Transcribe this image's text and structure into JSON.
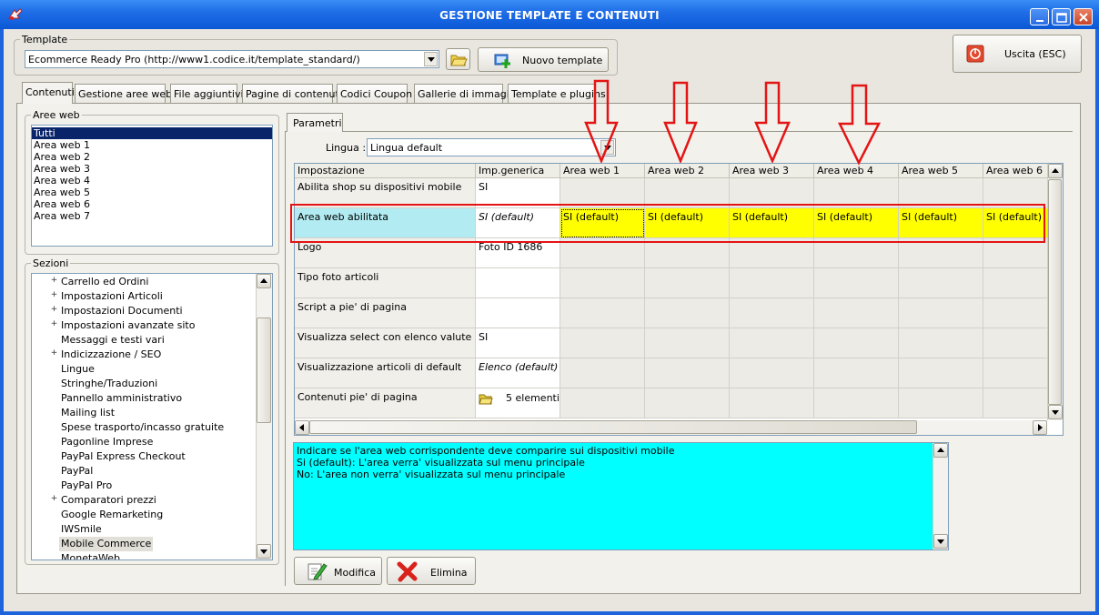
{
  "window": {
    "title": "GESTIONE TEMPLATE E CONTENUTI"
  },
  "template": {
    "legend": "Template",
    "selected": "Ecommerce Ready Pro (http://www1.codice.it/template_standard/)",
    "new_button": "Nuovo template"
  },
  "exit_button": "Uscita (ESC)",
  "tabs": [
    "Contenuti",
    "Gestione aree web",
    "File aggiuntivi",
    "Pagine di contenuti",
    "Codici Coupon",
    "Gallerie di immagini",
    "Template e plugins"
  ],
  "aree_web": {
    "legend": "Aree web",
    "items": [
      "Tutti",
      "Area web 1",
      "Area web 2",
      "Area web 3",
      "Area web 4",
      "Area web 5",
      "Area web 6",
      "Area web 7"
    ]
  },
  "sezioni": {
    "legend": "Sezioni",
    "items": [
      {
        "label": "Carrello ed Ordini",
        "expandable": true
      },
      {
        "label": "Impostazioni Articoli",
        "expandable": true
      },
      {
        "label": "Impostazioni Documenti",
        "expandable": true
      },
      {
        "label": "Impostazioni avanzate sito",
        "expandable": true
      },
      {
        "label": "Messaggi e testi vari",
        "expandable": false
      },
      {
        "label": "Indicizzazione / SEO",
        "expandable": true
      },
      {
        "label": "Lingue",
        "expandable": false
      },
      {
        "label": "Stringhe/Traduzioni",
        "expandable": false
      },
      {
        "label": "Pannello amministrativo",
        "expandable": false
      },
      {
        "label": "Mailing list",
        "expandable": false
      },
      {
        "label": "Spese trasporto/incasso gratuite",
        "expandable": false
      },
      {
        "label": "Pagonline Imprese",
        "expandable": false
      },
      {
        "label": "PayPal Express Checkout",
        "expandable": false
      },
      {
        "label": "PayPal",
        "expandable": false
      },
      {
        "label": "PayPal Pro",
        "expandable": false
      },
      {
        "label": "Comparatori prezzi",
        "expandable": true
      },
      {
        "label": "Google Remarketing",
        "expandable": false
      },
      {
        "label": "IWSmile",
        "expandable": false
      },
      {
        "label": "Mobile Commerce",
        "expandable": false,
        "selected": true
      },
      {
        "label": "MonetaWeb",
        "expandable": false
      }
    ]
  },
  "parametri": {
    "tab": "Parametri",
    "lingua_label": "Lingua :",
    "lingua_value": "Lingua default"
  },
  "grid": {
    "columns": [
      "Impostazione",
      "Imp.generica",
      "Area web 1",
      "Area web 2",
      "Area web 3",
      "Area web 4",
      "Area web 5",
      "Area web 6"
    ],
    "rows": [
      {
        "name": "Abilita shop su dispositivi mobile",
        "generic": "SI",
        "italic": false,
        "areas": [
          "",
          "",
          "",
          "",
          "",
          ""
        ]
      },
      {
        "name": "Area web abilitata",
        "generic": "SI (default)",
        "italic": true,
        "highlight": true,
        "areas": [
          "SI (default)",
          "SI (default)",
          "SI (default)",
          "SI (default)",
          "SI (default)",
          "SI (default)"
        ]
      },
      {
        "name": "Logo",
        "generic": "Foto ID 1686",
        "italic": false,
        "areas": [
          "",
          "",
          "",
          "",
          "",
          ""
        ]
      },
      {
        "name": "Tipo foto articoli",
        "generic": "",
        "italic": false,
        "areas": [
          "",
          "",
          "",
          "",
          "",
          ""
        ]
      },
      {
        "name": "Script a pie' di pagina",
        "generic": "",
        "italic": false,
        "areas": [
          "",
          "",
          "",
          "",
          "",
          ""
        ]
      },
      {
        "name": "Visualizza select con elenco valute",
        "generic": "SI",
        "italic": false,
        "areas": [
          "",
          "",
          "",
          "",
          "",
          ""
        ]
      },
      {
        "name": "Visualizzazione articoli di default",
        "generic": "Elenco (default)",
        "italic": true,
        "areas": [
          "",
          "",
          "",
          "",
          "",
          ""
        ]
      },
      {
        "name": "Contenuti pie' di pagina",
        "generic": "5 elementi",
        "italic": false,
        "icon": "folder-icon",
        "areas": [
          "",
          "",
          "",
          "",
          "",
          ""
        ]
      }
    ]
  },
  "description": [
    "Indicare se l'area web corrispondente deve comparire sui dispositivi mobile",
    "Si (default): L'area verra' visualizzata sul menu principale",
    "No: L'area non verra' visualizzata sul menu principale"
  ],
  "buttons": {
    "modifica": "Modifica",
    "elimina": "Elimina"
  },
  "colors": {
    "highlight_row": "#ffff00",
    "highlight_name": "#b2ecf2",
    "description_bg": "#00ffff",
    "annotation": "#e41414",
    "titlebar": "#1f6ee8"
  }
}
